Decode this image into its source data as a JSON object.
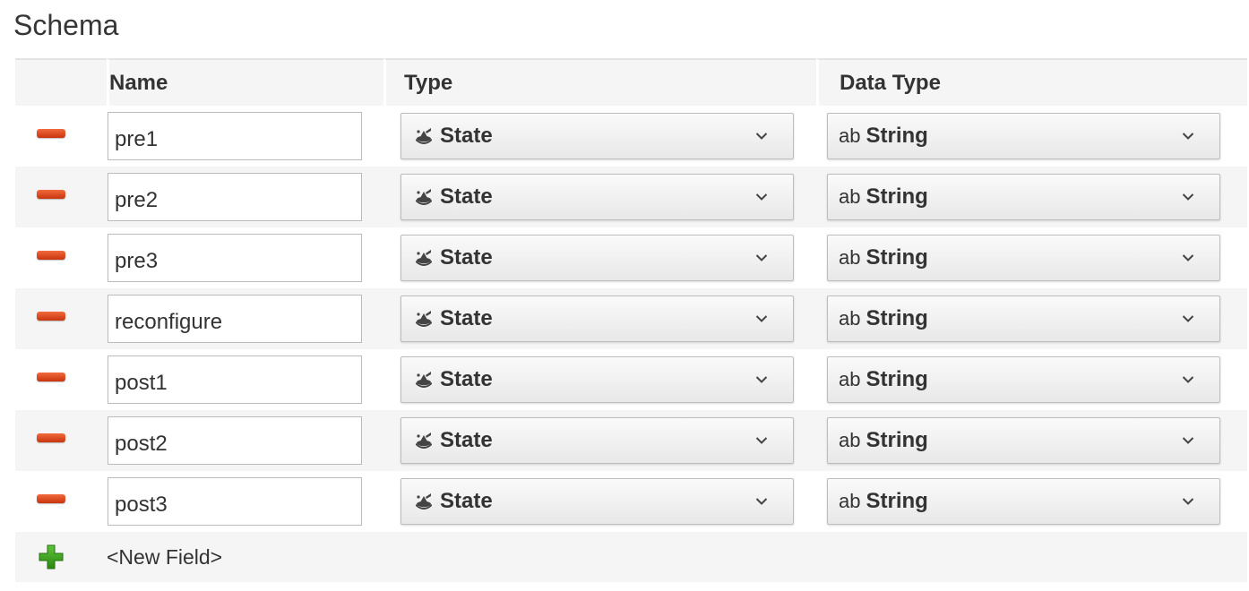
{
  "section_title": "Schema",
  "columns": {
    "name": "Name",
    "type": "Type",
    "data_type": "Data Type"
  },
  "rows": [
    {
      "name": "pre1",
      "type": "State",
      "data_type_prefix": "ab",
      "data_type": "String"
    },
    {
      "name": "pre2",
      "type": "State",
      "data_type_prefix": "ab",
      "data_type": "String"
    },
    {
      "name": "pre3",
      "type": "State",
      "data_type_prefix": "ab",
      "data_type": "String"
    },
    {
      "name": "reconfigure",
      "type": "State",
      "data_type_prefix": "ab",
      "data_type": "String"
    },
    {
      "name": "post1",
      "type": "State",
      "data_type_prefix": "ab",
      "data_type": "String"
    },
    {
      "name": "post2",
      "type": "State",
      "data_type_prefix": "ab",
      "data_type": "String"
    },
    {
      "name": "post3",
      "type": "State",
      "data_type_prefix": "ab",
      "data_type": "String"
    }
  ],
  "new_field_label": "<New Field>",
  "icons": {
    "remove": "minus-icon",
    "add": "plus-icon",
    "type": "state-icon",
    "dropdown": "chevron-down-icon"
  },
  "colors": {
    "remove": "#d9461c",
    "add": "#3a9a1c",
    "row_alt": "#f5f5f5"
  }
}
